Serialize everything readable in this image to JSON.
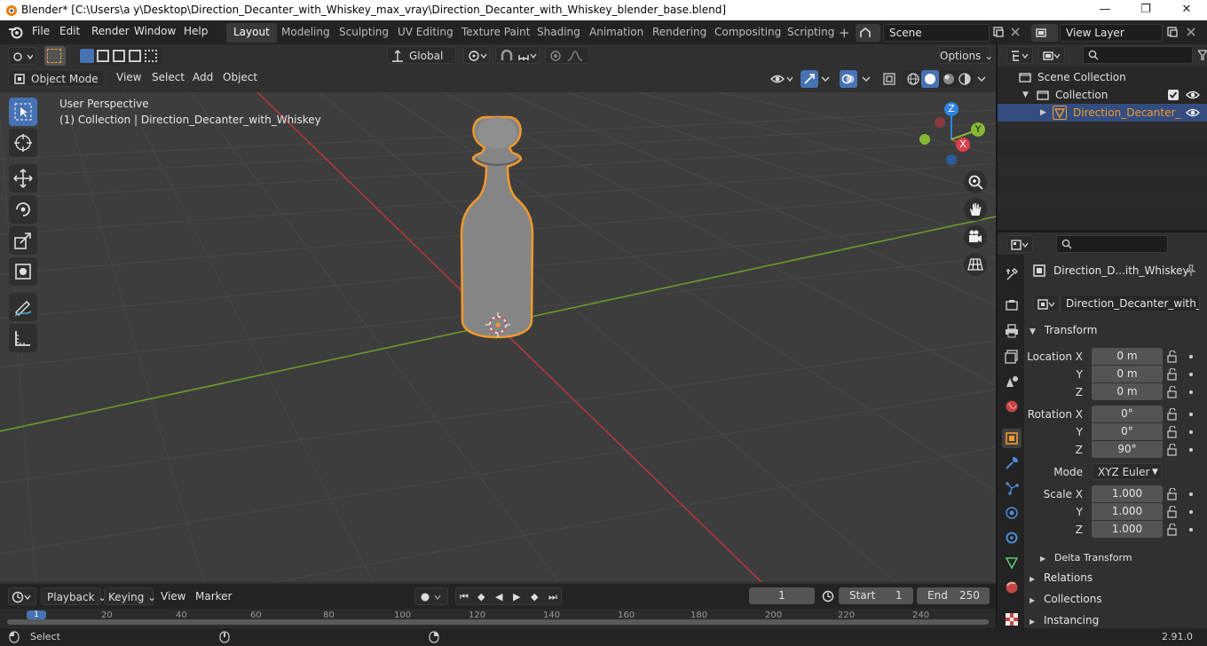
{
  "window": {
    "title": "Blender* [C:\\Users\\a y\\Desktop\\Direction_Decanter_with_Whiskey_max_vray\\Direction_Decanter_with_Whiskey_blender_base.blend]",
    "minimize": "—",
    "maximize": "❐",
    "close": "✕"
  },
  "menubar": {
    "items": [
      "File",
      "Edit",
      "Render",
      "Window",
      "Help"
    ]
  },
  "workspaces": [
    "Layout",
    "Modeling",
    "Sculpting",
    "UV Editing",
    "Texture Paint",
    "Shading",
    "Animation",
    "Rendering",
    "Compositing",
    "Scripting"
  ],
  "active_workspace": "Layout",
  "scene": {
    "name": "Scene"
  },
  "view_layer": {
    "name": "View Layer"
  },
  "viewport_header": {
    "transform_orientation": "Global",
    "options_label": "Options",
    "mode": "Object Mode",
    "menus": [
      "View",
      "Select",
      "Add",
      "Object"
    ]
  },
  "viewport": {
    "perspective": "User Perspective",
    "collection_info": "(1) Collection | Direction_Decanter_with_Whiskey",
    "gizmo": {
      "x": "X",
      "y": "Y",
      "z": "Z"
    }
  },
  "outliner": {
    "scene_collection": "Scene Collection",
    "collection": "Collection",
    "object": "Direction_Decanter_"
  },
  "properties": {
    "object_name": "Direction_D...ith_Whiskey",
    "object_datablock": "Direction_Decanter_with_W...",
    "transform_label": "Transform",
    "location": {
      "label_x": "Location X",
      "x": "0 m",
      "y": "0 m",
      "z": "0 m"
    },
    "rotation": {
      "label_x": "Rotation X",
      "x": "0°",
      "y": "0°",
      "z": "90°"
    },
    "mode_label": "Mode",
    "mode_value": "XYZ Euler",
    "scale": {
      "label_x": "Scale X",
      "x": "1.000",
      "y": "1.000",
      "z": "1.000"
    },
    "axis_y": "Y",
    "axis_z": "Z",
    "sections": [
      "Delta Transform",
      "Relations",
      "Collections",
      "Instancing"
    ]
  },
  "timeline": {
    "menus": [
      "Playback",
      "Keying",
      "View",
      "Marker"
    ],
    "current_frame": "1",
    "start_label": "Start",
    "start": "1",
    "end_label": "End",
    "end": "250",
    "ruler": [
      "1",
      "20",
      "40",
      "60",
      "80",
      "100",
      "120",
      "140",
      "160",
      "180",
      "200",
      "220",
      "240"
    ]
  },
  "status": {
    "left": "Select",
    "version": "2.91.0"
  },
  "colors": {
    "accent": "#4772b3",
    "selection_outline": "#f19a2b",
    "x_axis": "#d9414b",
    "y_axis": "#87b833",
    "z_axis": "#2f83e0"
  }
}
